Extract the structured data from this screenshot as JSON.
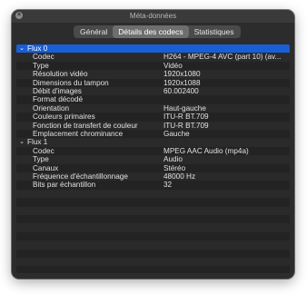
{
  "window": {
    "title": "Méta-données",
    "close_glyph": "×"
  },
  "tabs": [
    {
      "label": "Général",
      "active": false
    },
    {
      "label": "Détails des codecs",
      "active": true
    },
    {
      "label": "Statistiques",
      "active": false
    }
  ],
  "streams": [
    {
      "label": "Flux 0",
      "expanded": true,
      "rows": [
        {
          "key": "Codec",
          "value": "H264 - MPEG-4 AVC (part 10) (av..."
        },
        {
          "key": "Type",
          "value": "Vidéo"
        },
        {
          "key": "Résolution vidéo",
          "value": "1920x1080"
        },
        {
          "key": "Dimensions du tampon",
          "value": "1920x1088"
        },
        {
          "key": "Débit d'images",
          "value": "60.002400"
        },
        {
          "key": "Format décodé",
          "value": ""
        },
        {
          "key": "Orientation",
          "value": "Haut-gauche"
        },
        {
          "key": "Couleurs primaires",
          "value": "ITU-R BT.709"
        },
        {
          "key": "Fonction de transfert de couleur",
          "value": "ITU-R BT.709"
        },
        {
          "key": "Emplacement chrominance",
          "value": "Gauche"
        }
      ]
    },
    {
      "label": "Flux 1",
      "expanded": true,
      "rows": [
        {
          "key": "Codec",
          "value": "MPEG AAC Audio (mp4a)"
        },
        {
          "key": "Type",
          "value": "Audio"
        },
        {
          "key": "Canaux",
          "value": "Stéréo"
        },
        {
          "key": "Fréquence d'échantillonnage",
          "value": "48000 Hz"
        },
        {
          "key": "Bits par échantillon",
          "value": "32"
        }
      ]
    }
  ],
  "icons": {
    "expanded_chevron": "chevron-down-icon"
  },
  "colors": {
    "selection": "#1a5ed6",
    "window_bg": "#2c2c2c"
  }
}
